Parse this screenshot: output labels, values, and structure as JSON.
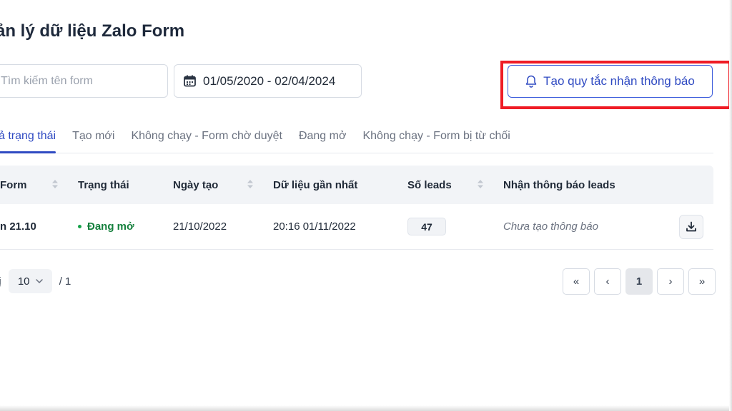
{
  "page": {
    "title": "ản lý dữ liệu Zalo Form"
  },
  "filters": {
    "search_placeholder": "Tìm kiếm tên form",
    "date_range": "01/05/2020 - 02/04/2024"
  },
  "notify_button": {
    "label": "Tạo quy tắc nhận thông báo",
    "icon": "bell-icon"
  },
  "tabs": [
    {
      "label": "cả trạng thái",
      "active": true
    },
    {
      "label": "Tạo mới",
      "active": false
    },
    {
      "label": "Không chạy - Form chờ duyệt",
      "active": false
    },
    {
      "label": "Đang mở",
      "active": false
    },
    {
      "label": "Không chạy - Form bị từ chối",
      "active": false
    }
  ],
  "table": {
    "columns": [
      "Form",
      "Trạng thái",
      "Ngày tạo",
      "Dữ liệu gần nhất",
      "Số leads",
      "Nhận thông báo leads"
    ],
    "rows": [
      {
        "form": "n 21.10",
        "status": "Đang mở",
        "created": "21/10/2022",
        "latest": "20:16 01/11/2022",
        "leads": "47",
        "notify": "Chưa tạo thông báo"
      }
    ]
  },
  "pagination": {
    "prefix": "hị",
    "page_size": "10",
    "total_pages": "/ 1",
    "current_page": "1",
    "first": "«",
    "prev": "‹",
    "next": "›",
    "last": "»"
  },
  "colors": {
    "accent": "#2f4ac2",
    "highlight": "#ef1c25",
    "status_open": "#15803d"
  }
}
